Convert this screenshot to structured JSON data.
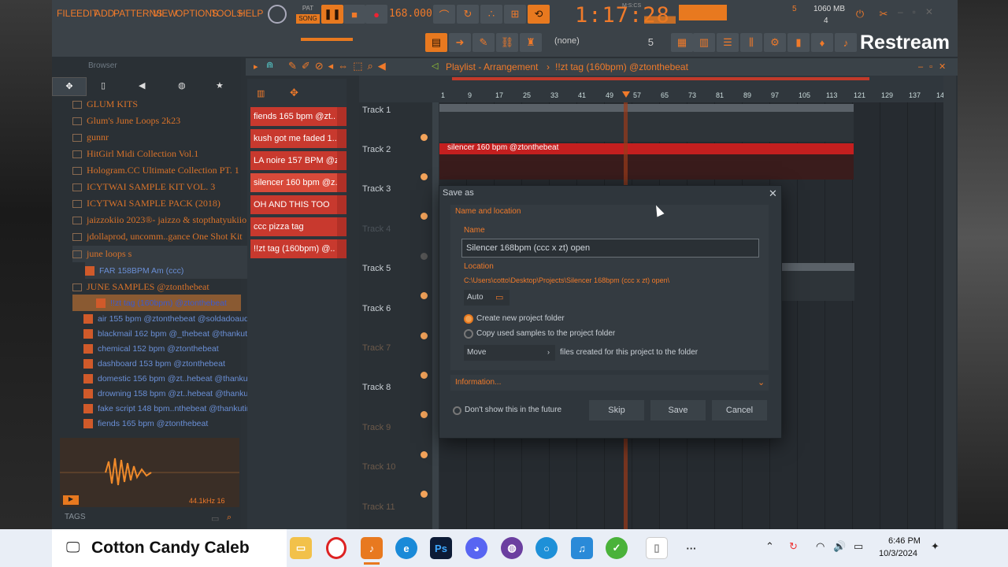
{
  "menu": [
    "FILE",
    "EDIT",
    "ADD",
    "PATTERNS",
    "VIEW",
    "OPTIONS",
    "TOOLS",
    "HELP"
  ],
  "transport": {
    "pat": "PAT",
    "song": "SONG",
    "bpm": "168.000",
    "time": "1:17:28",
    "time_unit": "M:S:CS",
    "mem": "1060 MB",
    "mem2": "4",
    "cpu": "5",
    "pattern_sel": "(none)",
    "step": "5"
  },
  "restream": "Restream",
  "browser": {
    "title": "Browser",
    "items": [
      "GLUM KITS",
      "Glum's June Loops 2k23",
      "gunnr",
      "HitGirl Midi Collection Vol.1",
      "Hologram.CC Ultimate Collection PT. 1",
      "ICYTWAI SAMPLE KIT VOL. 3",
      "ICYTWAI SAMPLE PACK (2018)",
      "jaizzokiio 2023®- jaizzo & stopthatyukiio",
      "jdollaprod, uncomm..gance One Shot Kit",
      "june loops s"
    ],
    "sub_item": "FAR 158BPM Am (ccc)",
    "june_samples": "JUNE SAMPLES @ztonthebeat",
    "selected": "!!zt tag (160bpm) @ztonthebeat",
    "files": [
      "air 155 bpm @ztonthebeat @soldadoaudio",
      "blackmail 162 bpm @_thebeat @thankutimmy",
      "chemical 152 bpm @ztonthebeat",
      "dashboard 153 bpm @ztonthebeat",
      "domestic 156 bpm @zt..hebeat @thankutimmy",
      "drowning 158 bpm @zt..hebeat @thankutimmy",
      "fake script 148 bpm..nthebeat @thankutimmy",
      "fiends 165 bpm @ztonthebeat"
    ],
    "sample_info": "44.1kHz 16",
    "tags": "TAGS"
  },
  "patterns": [
    "fiends 165 bpm @zt..",
    "kush got me faded 1..",
    "LA noire 157 BPM @z..",
    "silencer 160 bpm @z..",
    "OH AND THIS TOO",
    "ccc pizza tag",
    "!!zt tag (160bpm) @.."
  ],
  "playlist": {
    "title": "Playlist - Arrangement",
    "sep": "›",
    "project": "!!zt tag (160bpm) @ztonthebeat",
    "clip": "silencer 160 bpm @ztonthebeat",
    "bars": [
      "1",
      "9",
      "17",
      "25",
      "33",
      "41",
      "49",
      "57",
      "65",
      "73",
      "81",
      "89",
      "97",
      "105",
      "113",
      "121",
      "129",
      "137",
      "14"
    ],
    "tracks": [
      "Track 1",
      "Track 2",
      "Track 3",
      "Track 4",
      "Track 5",
      "Track 6",
      "Track 7",
      "Track 8",
      "Track 9",
      "Track 10",
      "Track 11"
    ]
  },
  "dialog": {
    "title": "Save as",
    "section": "Name and location",
    "name_label": "Name",
    "name_value": "Silencer 168bpm (ccc x zt) open",
    "location_label": "Location",
    "location_value": "C:\\Users\\cotto\\Desktop\\Projects\\Silencer 168bpm (ccc x zt) open\\",
    "auto": "Auto",
    "opt1": "Create new project folder",
    "opt2": "Copy used samples to the project folder",
    "move": "Move",
    "move_suffix": "files created for this project to the folder",
    "information": "Information...",
    "dont_show": "Don't show this in the future",
    "skip": "Skip",
    "save": "Save",
    "cancel": "Cancel"
  },
  "taskbar": {
    "streamer": "Cotton Candy Caleb",
    "time": "6:46 PM",
    "date": "10/3/2024",
    "ps": "Ps",
    "more": "···"
  }
}
